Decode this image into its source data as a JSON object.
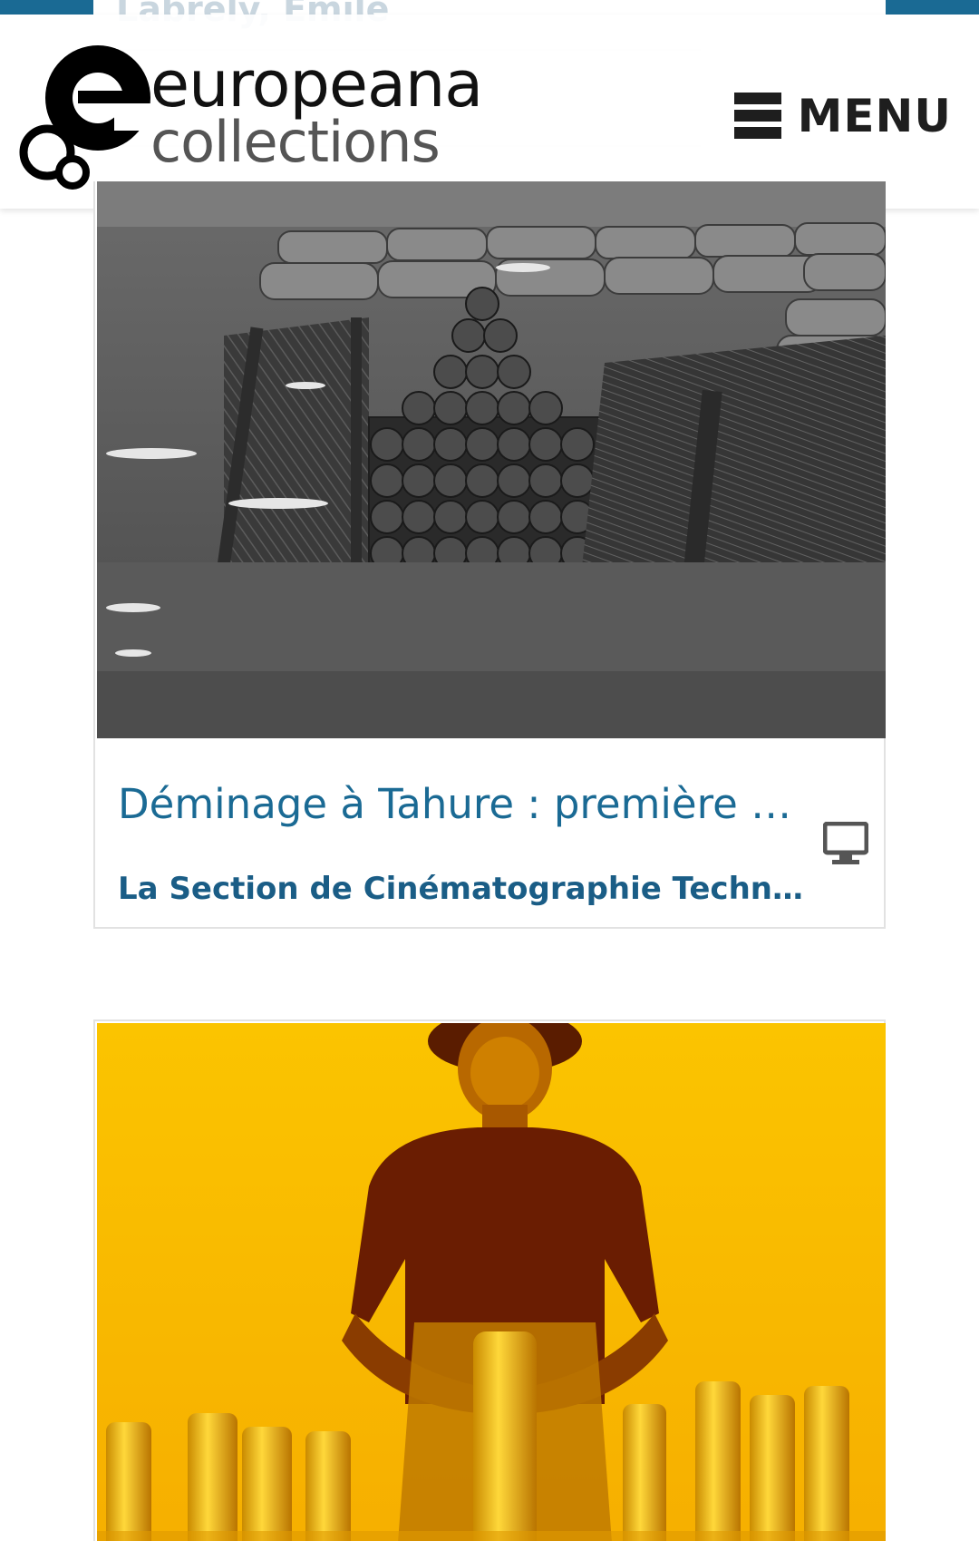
{
  "header": {
    "brand_name": "europeana",
    "brand_sub": "collections",
    "menu_label": "MENU",
    "menu_icon": "hamburger-icon"
  },
  "previous_card": {
    "creator_partial": "Labrely, Emile"
  },
  "results": [
    {
      "title": "Déminage à Tahure : première e…",
      "provider": "La Section de Cinématographie Techniq…",
      "media_type_icon": "monitor-icon",
      "image_tone": "black-and-white"
    },
    {
      "image_tone": "yellow-tinted"
    }
  ],
  "colors": {
    "top_bar": "#1a6a94",
    "title_link": "#1a6a94",
    "provider_text": "#1a5d86",
    "brand_text": "#111111",
    "menu_text": "#1e1e1e"
  }
}
